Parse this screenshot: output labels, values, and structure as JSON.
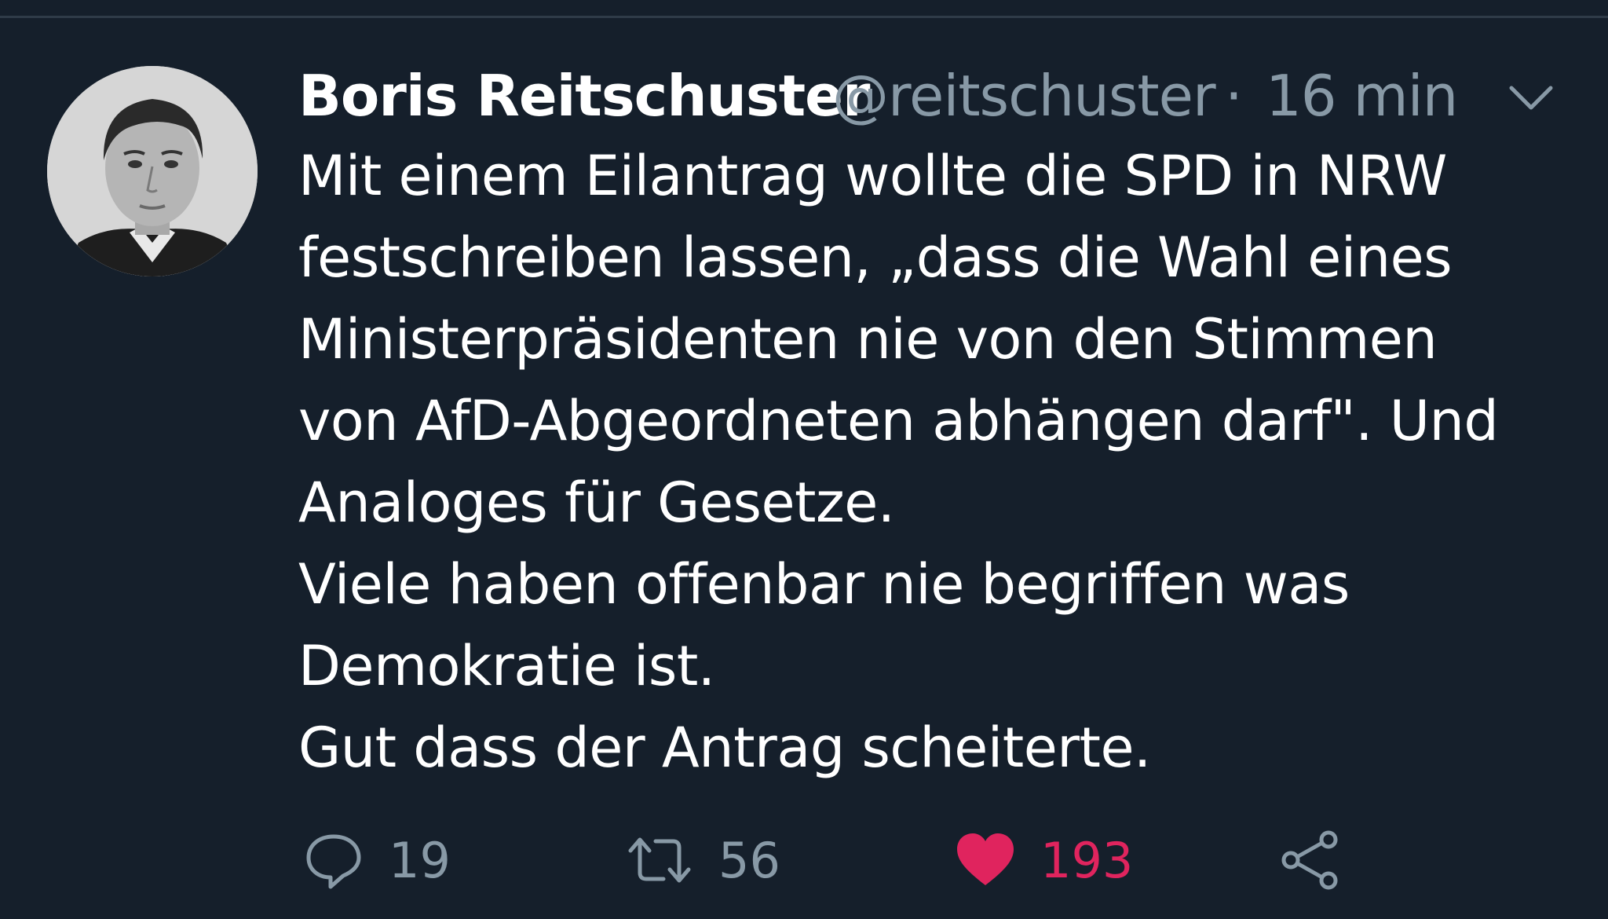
{
  "tweet": {
    "author": {
      "display_name": "Boris Reitschuster",
      "handle": "@reitschuster"
    },
    "separator": "·",
    "time": "16 min",
    "menu_icon": "chevron-down-icon",
    "text_lines": [
      "Mit einem Eilantrag wollte die SPD in NRW",
      "festschreiben lassen, „dass die Wahl eines",
      "Ministerpräsidenten nie von den Stimmen",
      "von AfD-Abgeordneten abhängen darf\". Und",
      "Analoges für Gesetze.",
      "Viele haben offenbar nie begriffen was",
      "Demokratie ist.",
      "Gut dass der Antrag scheiterte."
    ],
    "actions": {
      "reply": {
        "icon": "reply-icon",
        "count": "19"
      },
      "retweet": {
        "icon": "retweet-icon",
        "count": "56"
      },
      "like": {
        "icon": "heart-icon",
        "count": "193",
        "active": true
      },
      "share": {
        "icon": "share-icon"
      }
    }
  },
  "colors": {
    "background": "#151f2b",
    "primary_text": "#ffffff",
    "secondary_text": "#8899a6",
    "like_active": "#e0245e"
  }
}
